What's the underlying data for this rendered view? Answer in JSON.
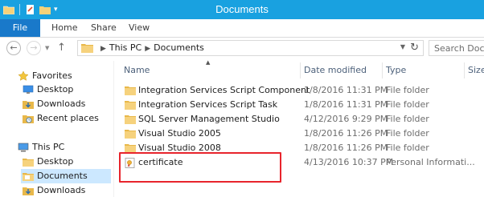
{
  "window": {
    "title": "Documents"
  },
  "ribbon": {
    "tabs": [
      {
        "label": "File"
      },
      {
        "label": "Home"
      },
      {
        "label": "Share"
      },
      {
        "label": "View"
      }
    ]
  },
  "address": {
    "crumbs": [
      "This PC",
      "Documents"
    ],
    "search_placeholder": "Search Docum"
  },
  "navpane": {
    "items": [
      {
        "label": "Favorites",
        "icon": "star-icon"
      },
      {
        "label": "Desktop",
        "icon": "desktop-icon"
      },
      {
        "label": "Downloads",
        "icon": "downloads-icon"
      },
      {
        "label": "Recent places",
        "icon": "recent-places-icon"
      },
      {
        "label": "This PC",
        "icon": "computer-icon"
      },
      {
        "label": "Desktop",
        "icon": "folder-icon"
      },
      {
        "label": "Documents",
        "icon": "folder-icon"
      },
      {
        "label": "Downloads",
        "icon": "downloads-icon"
      }
    ]
  },
  "columns": {
    "name": "Name",
    "date": "Date modified",
    "type": "Type",
    "size": "Size"
  },
  "files": [
    {
      "name": "Integration Services Script Component",
      "date": "1/8/2016 11:31 PM",
      "type": "File folder",
      "icon": "folder-icon"
    },
    {
      "name": "Integration Services Script Task",
      "date": "1/8/2016 11:31 PM",
      "type": "File folder",
      "icon": "folder-icon"
    },
    {
      "name": "SQL Server Management Studio",
      "date": "4/12/2016 9:29 PM",
      "type": "File folder",
      "icon": "folder-icon"
    },
    {
      "name": "Visual Studio 2005",
      "date": "1/8/2016 11:26 PM",
      "type": "File folder",
      "icon": "folder-icon"
    },
    {
      "name": "Visual Studio 2008",
      "date": "1/8/2016 11:26 PM",
      "type": "File folder",
      "icon": "folder-icon"
    },
    {
      "name": "certificate",
      "date": "4/13/2016 10:37 PM",
      "type": "Personal Informati...",
      "icon": "certificate-icon"
    }
  ],
  "colors": {
    "title_bar": "#19a1e0",
    "file_tab": "#1979ca",
    "selected": "#cce8ff",
    "highlight": "#e8242c",
    "folder": "#e8b84a"
  }
}
